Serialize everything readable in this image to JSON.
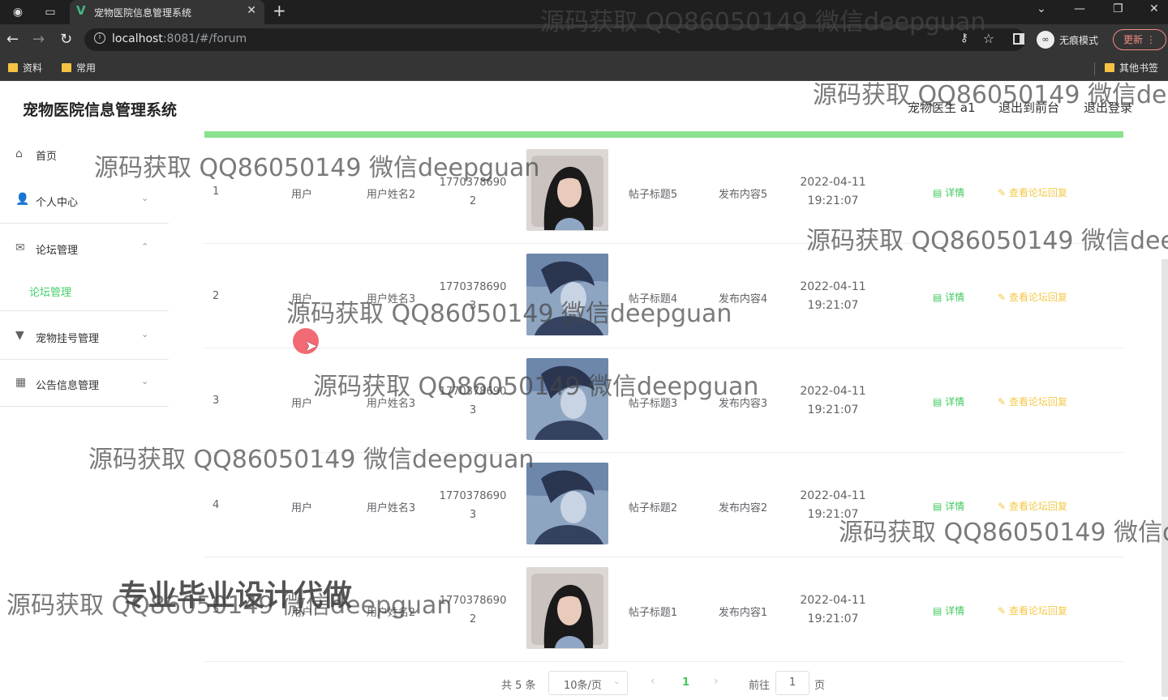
{
  "browser": {
    "tab_title": "宠物医院信息管理系统",
    "url_host": "localhost",
    "url_rest": ":8081/#/forum",
    "incognito_label": "无痕模式",
    "update_label": "更新",
    "bookmarks": [
      "资料",
      "常用"
    ],
    "other_bookmarks": "其他书签"
  },
  "header": {
    "title": "宠物医院信息管理系统",
    "user": "宠物医生 a1",
    "back_front": "退出到前台",
    "logout": "退出登录"
  },
  "sidebar": {
    "items": [
      {
        "label": "首页",
        "icon": "home-icon"
      },
      {
        "label": "个人中心",
        "icon": "user-icon"
      },
      {
        "label": "论坛管理",
        "icon": "mail-icon"
      },
      {
        "label": "宠物挂号管理",
        "icon": "flag-icon"
      },
      {
        "label": "公告信息管理",
        "icon": "grid-icon"
      }
    ],
    "active_sub": "论坛管理"
  },
  "table": {
    "rows": [
      {
        "idx": "1",
        "type": "用户",
        "name": "用户姓名2",
        "phone1": "1770378690",
        "phone2": "2",
        "title": "帖子标题5",
        "content": "发布内容5",
        "date": "2022-04-11",
        "time": "19:21:07",
        "avatar": "woman"
      },
      {
        "idx": "2",
        "type": "用户",
        "name": "用户姓名3",
        "phone1": "1770378690",
        "phone2": "3",
        "title": "帖子标题4",
        "content": "发布内容4",
        "date": "2022-04-11",
        "time": "19:21:07",
        "avatar": "anime"
      },
      {
        "idx": "3",
        "type": "用户",
        "name": "用户姓名3",
        "phone1": "1770378690",
        "phone2": "3",
        "title": "帖子标题3",
        "content": "发布内容3",
        "date": "2022-04-11",
        "time": "19:21:07",
        "avatar": "anime"
      },
      {
        "idx": "4",
        "type": "用户",
        "name": "用户姓名3",
        "phone1": "1770378690",
        "phone2": "3",
        "title": "帖子标题2",
        "content": "发布内容2",
        "date": "2022-04-11",
        "time": "19:21:07",
        "avatar": "anime"
      },
      {
        "idx": "5",
        "type": "用户",
        "name": "用户姓名2",
        "phone1": "1770378690",
        "phone2": "2",
        "title": "帖子标题1",
        "content": "发布内容1",
        "date": "2022-04-11",
        "time": "19:21:07",
        "avatar": "woman"
      }
    ],
    "detail_label": "详情",
    "reply_label": "查看论坛回复"
  },
  "pagination": {
    "total": "共 5 条",
    "page_size": "10条/页",
    "current": "1",
    "goto": "前往",
    "goto_value": "1",
    "page_suffix": "页"
  },
  "watermarks": {
    "text": "源码获取 QQ86050149 微信deepguan",
    "bold": "专业毕业设计代做"
  }
}
